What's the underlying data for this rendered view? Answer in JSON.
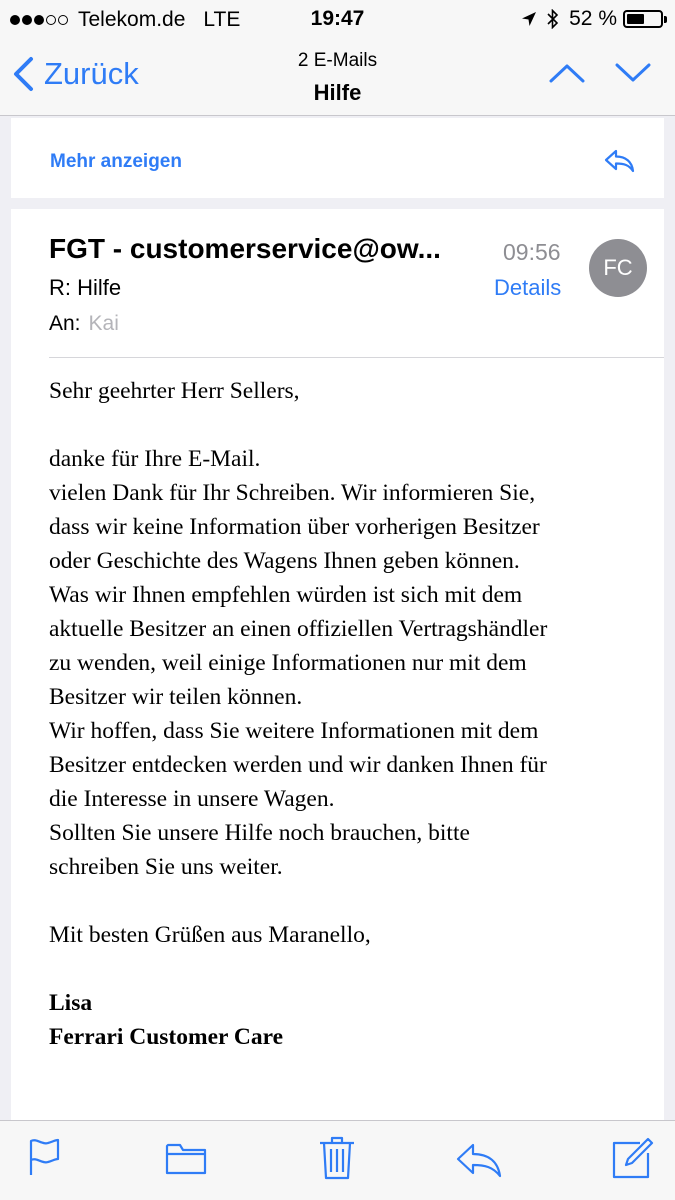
{
  "status_bar": {
    "carrier": "Telekom.de",
    "network": "LTE",
    "time": "19:47",
    "battery": "52 %",
    "battery_level": 0.52,
    "signal_bars_filled": 3,
    "signal_bars_total": 5
  },
  "nav": {
    "back_label": "Zurück",
    "subtitle": "2 E-Mails",
    "title": "Hilfe"
  },
  "collapsed_message": {
    "show_more_label": "Mehr anzeigen"
  },
  "mail": {
    "sender": "FGT - customerservice@ow...",
    "time": "09:56",
    "avatar_initials": "FC",
    "subject": "R: Hilfe",
    "details_label": "Details",
    "to_label": "An:",
    "to_name": "Kai",
    "body": {
      "greeting": "Sehr geehrter Herr Sellers,",
      "lines": [
        "danke für Ihre E-Mail.",
        "vielen Dank für Ihr Schreiben. Wir informieren Sie,",
        "dass wir keine Information über vorherigen Besitzer",
        "oder Geschichte des Wagens Ihnen geben können.",
        "Was wir Ihnen empfehlen würden ist sich mit dem",
        "aktuelle Besitzer an einen offiziellen Vertragshändler",
        "zu wenden, weil einige Informationen nur mit dem",
        "Besitzer wir teilen können.",
        "Wir hoffen, dass Sie weitere Informationen mit dem",
        "Besitzer entdecken werden und wir danken Ihnen für",
        "die Interesse in unsere Wagen.",
        "Sollten Sie unsere Hilfe noch brauchen, bitte",
        "schreiben Sie uns weiter."
      ],
      "closing": "Mit besten Grüßen aus Maranello,",
      "signature_name": "Lisa",
      "signature_company": "Ferrari Customer Care"
    }
  },
  "colors": {
    "accent": "#2f7cf6",
    "avatar_bg": "#8e8e93",
    "background": "#efeff4"
  },
  "toolbar_icons": [
    "flag-icon",
    "folder-icon",
    "trash-icon",
    "reply-icon",
    "compose-icon"
  ]
}
